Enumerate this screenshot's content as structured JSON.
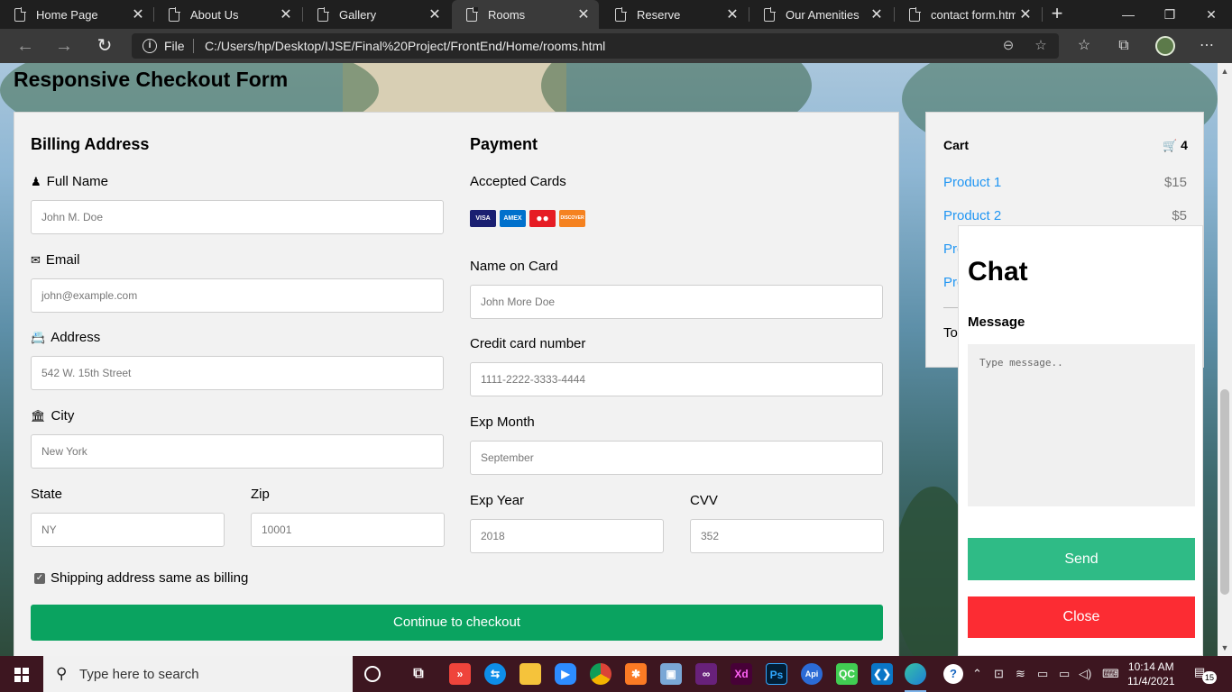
{
  "browser": {
    "tabs": [
      {
        "label": "Home Page"
      },
      {
        "label": "About Us"
      },
      {
        "label": "Gallery"
      },
      {
        "label": "Rooms"
      },
      {
        "label": "Reserve"
      },
      {
        "label": "Our Amenities"
      },
      {
        "label": "contact form.html"
      }
    ],
    "active_tab": "Rooms",
    "new_tab_symbol": "+",
    "url_scheme": "File",
    "url": "C:/Users/hp/Desktop/IJSE/Final%20Project/FrontEnd/Home/rooms.html",
    "icons": [
      "back-icon",
      "forward-icon",
      "refresh-icon",
      "info-icon",
      "zoom-icon",
      "add-favorite-icon",
      "favorites-icon",
      "collections-icon",
      "profile-avatar",
      "more-icon"
    ]
  },
  "page": {
    "title": "Responsive Checkout Form",
    "billing": {
      "heading": "Billing Address",
      "full_name_label": "Full Name",
      "full_name_placeholder": "John M. Doe",
      "email_label": "Email",
      "email_placeholder": "john@example.com",
      "address_label": "Address",
      "address_placeholder": "542 W. 15th Street",
      "city_label": "City",
      "city_placeholder": "New York",
      "state_label": "State",
      "state_placeholder": "NY",
      "zip_label": "Zip",
      "zip_placeholder": "10001",
      "shipping_same_label": "Shipping address same as billing",
      "shipping_same_checked": true
    },
    "payment": {
      "heading": "Payment",
      "accepted_cards_label": "Accepted Cards",
      "cards": [
        {
          "name": "VISA",
          "color": "#1a1f71"
        },
        {
          "name": "AMEX",
          "color": "#0070cc"
        },
        {
          "name": "MasterCard",
          "color": "#e61c24"
        },
        {
          "name": "DISCOVER",
          "color": "#f58220"
        }
      ],
      "name_on_card_label": "Name on Card",
      "name_on_card_placeholder": "John More Doe",
      "card_number_label": "Credit card number",
      "card_number_placeholder": "1111-2222-3333-4444",
      "exp_month_label": "Exp Month",
      "exp_month_placeholder": "September",
      "exp_year_label": "Exp Year",
      "exp_year_placeholder": "2018",
      "cvv_label": "CVV",
      "cvv_placeholder": "352"
    },
    "checkout_button": "Continue to checkout",
    "checkout_color": "#0aa360",
    "cart": {
      "title": "Cart",
      "count": "4",
      "items": [
        {
          "name": "Product 1",
          "price": "$15"
        },
        {
          "name": "Product 2",
          "price": "$5"
        },
        {
          "name": "Pro"
        },
        {
          "name": "Pro"
        }
      ],
      "total_label": "Tot"
    },
    "chat": {
      "heading": "Chat",
      "message_label": "Message",
      "message_placeholder": "Type message..",
      "send_button": "Send",
      "send_color": "#2fbb86",
      "close_button": "Close",
      "close_color": "#fc2c33"
    }
  },
  "taskbar": {
    "search_placeholder": "Type here to search",
    "apps": [
      "cortana-icon",
      "task-view-icon",
      "anydesk-icon",
      "teamviewer-icon",
      "file-explorer-icon",
      "zoom-icon",
      "chrome-icon",
      "xampp-icon",
      "virtualbox-icon",
      "visual-studio-icon",
      "adobe-xd-icon",
      "photoshop-icon",
      "postman-icon",
      "qt-creator-icon",
      "vscode-icon",
      "edge-icon"
    ],
    "xd_label": "Xd",
    "ps_label": "Ps",
    "qc_label": "QC",
    "clock_time": "10:14 AM",
    "clock_date": "11/4/2021",
    "notification_count": "15"
  }
}
